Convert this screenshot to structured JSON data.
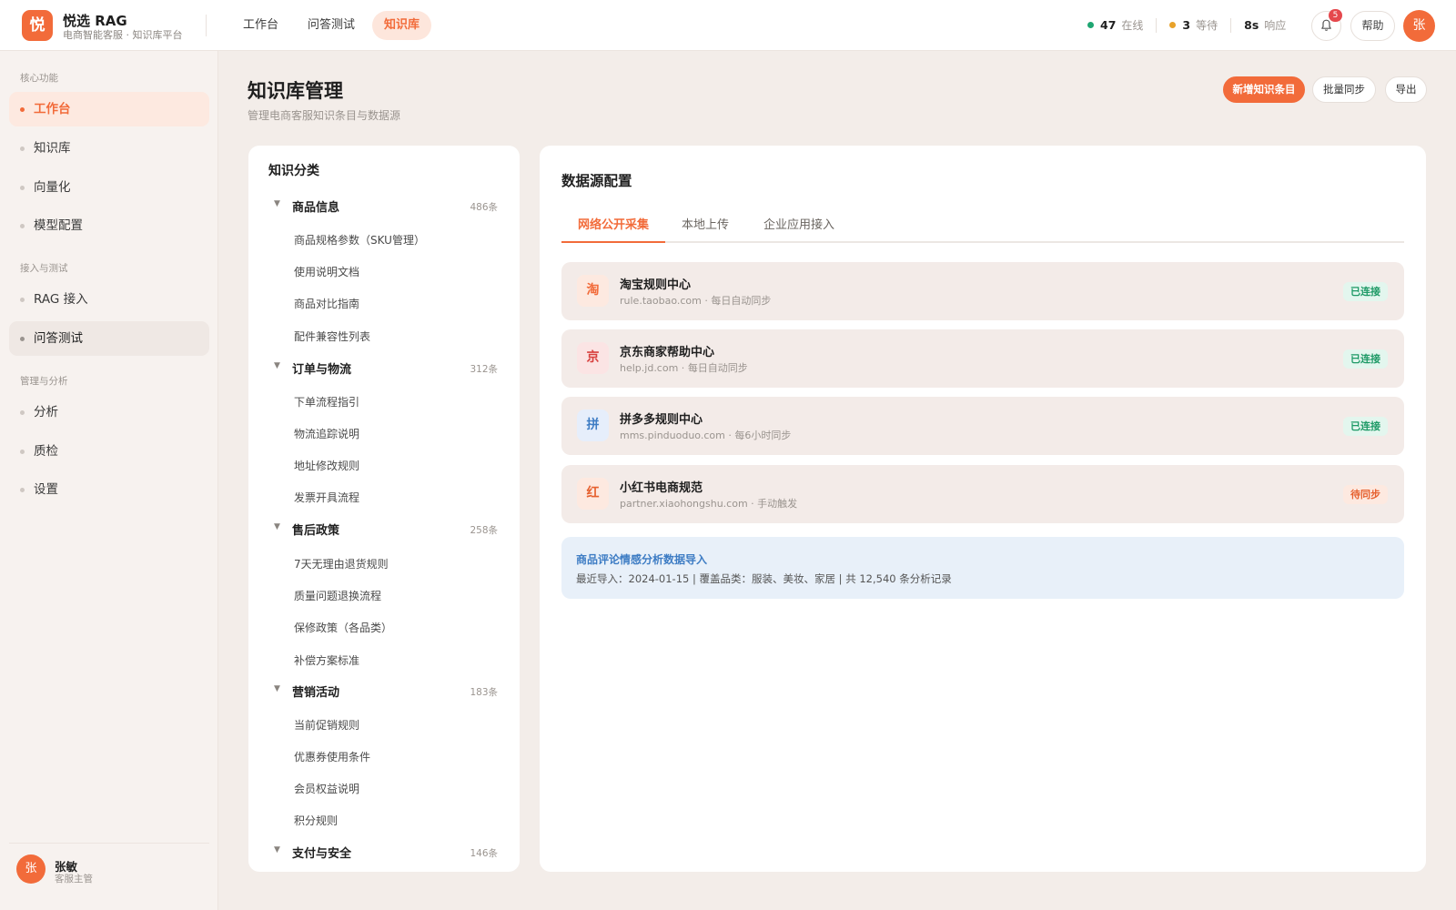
{
  "brand": {
    "logo_char": "悦",
    "name": "悦选 RAG",
    "subtitle": "电商智能客服 · 知识库平台"
  },
  "top_nav": [
    {
      "label": "工作台",
      "active": false
    },
    {
      "label": "问答测试",
      "active": false
    },
    {
      "label": "知识库",
      "active": true
    }
  ],
  "stats": [
    {
      "value": "47",
      "label": "在线",
      "color": "#1fa672"
    },
    {
      "value": "3",
      "label": "等待",
      "color": "#e8a22a"
    },
    {
      "value": "8s",
      "label": "响应",
      "color": ""
    }
  ],
  "notifications": {
    "count": "5"
  },
  "help_label": "帮助",
  "user": {
    "avatar_char": "张",
    "name": "张敏",
    "role": "客服主管"
  },
  "sidebar": {
    "sections": [
      {
        "title": "核心功能",
        "items": [
          {
            "label": "工作台",
            "state": "active"
          },
          {
            "label": "知识库",
            "state": ""
          },
          {
            "label": "向量化",
            "state": ""
          },
          {
            "label": "模型配置",
            "state": ""
          }
        ]
      },
      {
        "title": "接入与测试",
        "items": [
          {
            "label": "RAG 接入",
            "state": ""
          },
          {
            "label": "问答测试",
            "state": "hover"
          }
        ]
      },
      {
        "title": "管理与分析",
        "items": [
          {
            "label": "分析",
            "state": ""
          },
          {
            "label": "质检",
            "state": ""
          },
          {
            "label": "设置",
            "state": ""
          }
        ]
      }
    ]
  },
  "page": {
    "title": "知识库管理",
    "subtitle": "管理电商客服知识条目与数据源",
    "actions": {
      "add": "新增知识条目",
      "sync": "批量同步",
      "export": "导出"
    }
  },
  "categories": {
    "title": "知识分类",
    "groups": [
      {
        "name": "商品信息",
        "count": "486条",
        "children": [
          "商品规格参数（SKU管理）",
          "使用说明文档",
          "商品对比指南",
          "配件兼容性列表"
        ]
      },
      {
        "name": "订单与物流",
        "count": "312条",
        "children": [
          "下单流程指引",
          "物流追踪说明",
          "地址修改规则",
          "发票开具流程"
        ]
      },
      {
        "name": "售后政策",
        "count": "258条",
        "children": [
          "7天无理由退货规则",
          "质量问题退换流程",
          "保修政策（各品类）",
          "补偿方案标准"
        ]
      },
      {
        "name": "营销活动",
        "count": "183条",
        "children": [
          "当前促销规则",
          "优惠券使用条件",
          "会员权益说明",
          "积分规则"
        ]
      },
      {
        "name": "支付与安全",
        "count": "146条",
        "children": []
      }
    ]
  },
  "datasource": {
    "title": "数据源配置",
    "tabs": [
      {
        "label": "网络公开采集",
        "active": true
      },
      {
        "label": "本地上传",
        "active": false
      },
      {
        "label": "企业应用接入",
        "active": false
      }
    ],
    "sources": [
      {
        "icon_char": "淘",
        "icon_bg": "#fde9e0",
        "icon_color": "#f26b3a",
        "name": "淘宝规则中心",
        "domain": "rule.taobao.com",
        "schedule": "每日自动同步",
        "status": "已连接",
        "status_type": "ok"
      },
      {
        "icon_char": "京",
        "icon_bg": "#fbe4e4",
        "icon_color": "#d8413f",
        "name": "京东商家帮助中心",
        "domain": "help.jd.com",
        "schedule": "每日自动同步",
        "status": "已连接",
        "status_type": "ok"
      },
      {
        "icon_char": "拼",
        "icon_bg": "#e6eefb",
        "icon_color": "#3d7cc4",
        "name": "拼多多规则中心",
        "domain": "mms.pinduoduo.com",
        "schedule": "每6小时同步",
        "status": "已连接",
        "status_type": "ok"
      },
      {
        "icon_char": "红",
        "icon_bg": "#fde9e0",
        "icon_color": "#e6612f",
        "name": "小红书电商规范",
        "domain": "partner.xiaohongshu.com",
        "schedule": "手动触发",
        "status": "待同步",
        "status_type": "pending"
      }
    ],
    "info": {
      "title": "商品评论情感分析数据导入",
      "detail": "最近导入：2024-01-15 | 覆盖品类：服装、美妆、家居 | 共 12,540 条分析记录"
    }
  }
}
